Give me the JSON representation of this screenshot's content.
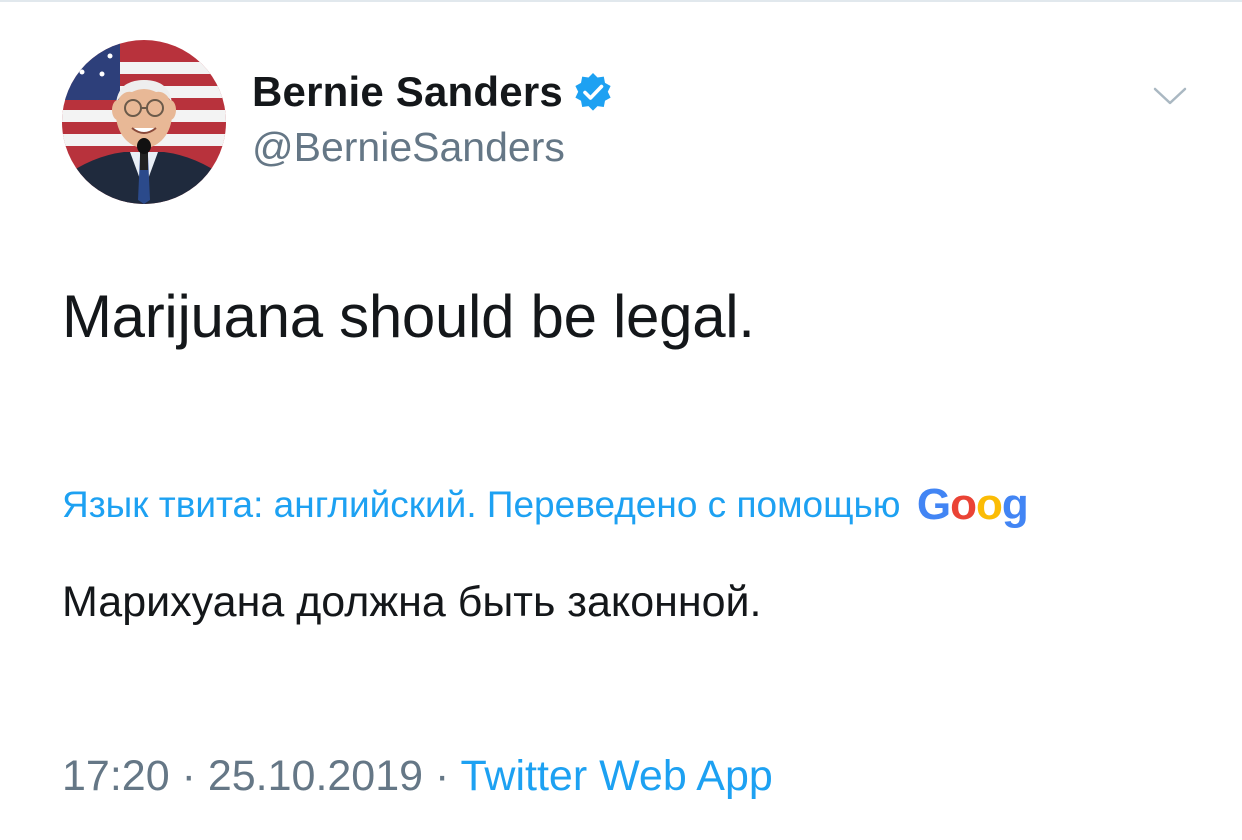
{
  "author": {
    "display_name": "Bernie Sanders",
    "handle": "@BernieSanders",
    "verified": true,
    "verified_icon": "verified-badge-icon",
    "avatar_icon": "profile-photo"
  },
  "menu": {
    "icon": "chevron-down-icon"
  },
  "tweet": {
    "text": "Marijuana should be legal."
  },
  "translation": {
    "notice": "Язык твита: английский. Переведено с помощью",
    "provider_logo_text": "Goog",
    "translated_text": "Марихуана должна быть законной."
  },
  "meta": {
    "time": "17:20",
    "separator": "·",
    "date": "25.10.2019",
    "source": "Twitter Web App"
  },
  "colors": {
    "link": "#1da1f2",
    "primary_text": "#14171a",
    "secondary_text": "#657786",
    "verified": "#1da1f2"
  }
}
